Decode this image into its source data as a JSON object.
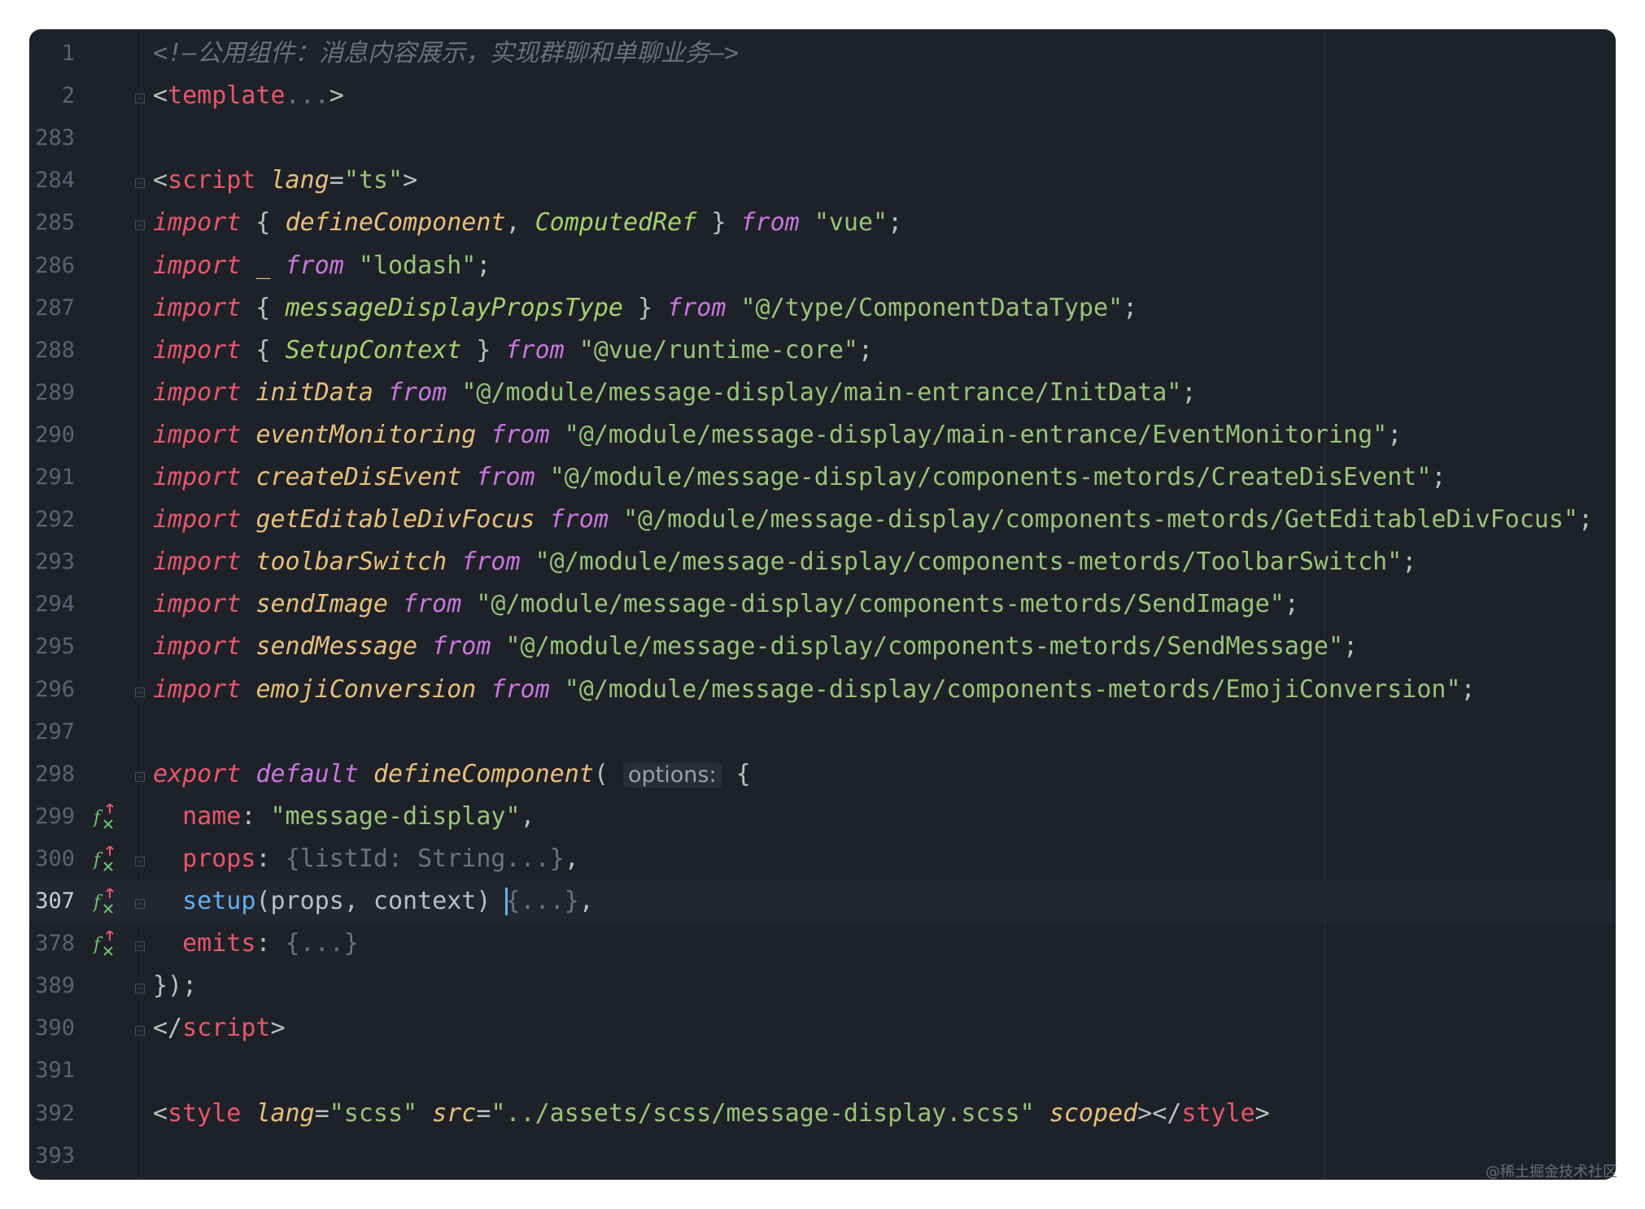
{
  "colors": {
    "background": "#1f2129",
    "keyword": "#e5586b",
    "keyword2": "#c678dd",
    "function": "#e5c07b",
    "string": "#98c379",
    "type": "#a6d06e",
    "comment": "#6b6f7b",
    "setup": "#61afef"
  },
  "editor": {
    "lines": [
      {
        "n": "1",
        "fold": false,
        "icon": null,
        "tokens": [
          {
            "c": "comment",
            "t": "<!—公用组件：消息内容展示，实现群聊和单聊业务—>"
          }
        ]
      },
      {
        "n": "2",
        "fold": true,
        "icon": null,
        "tokens": [
          {
            "c": "plain",
            "t": "<"
          },
          {
            "c": "tag",
            "t": "template"
          },
          {
            "c": "dim",
            "t": "..."
          },
          {
            "c": "plain",
            "t": ">"
          }
        ]
      },
      {
        "n": "283",
        "fold": false,
        "icon": null,
        "tokens": []
      },
      {
        "n": "284",
        "fold": true,
        "icon": null,
        "tokens": [
          {
            "c": "plain",
            "t": "<"
          },
          {
            "c": "tag",
            "t": "script"
          },
          {
            "c": "plain",
            "t": " "
          },
          {
            "c": "attr",
            "t": "lang"
          },
          {
            "c": "plain",
            "t": "="
          },
          {
            "c": "str",
            "t": "\"ts\""
          },
          {
            "c": "plain",
            "t": ">"
          }
        ]
      },
      {
        "n": "285",
        "fold": true,
        "icon": null,
        "tokens": [
          {
            "c": "kw",
            "t": "import"
          },
          {
            "c": "plain",
            "t": " { "
          },
          {
            "c": "fn",
            "t": "defineComponent"
          },
          {
            "c": "plain",
            "t": ", "
          },
          {
            "c": "ty",
            "t": "ComputedRef"
          },
          {
            "c": "plain",
            "t": " } "
          },
          {
            "c": "kw2",
            "t": "from"
          },
          {
            "c": "plain",
            "t": " "
          },
          {
            "c": "str",
            "t": "\"vue\""
          },
          {
            "c": "plain",
            "t": ";"
          }
        ]
      },
      {
        "n": "286",
        "fold": false,
        "icon": null,
        "tokens": [
          {
            "c": "kw",
            "t": "import"
          },
          {
            "c": "plain",
            "t": " "
          },
          {
            "c": "fn",
            "t": "_"
          },
          {
            "c": "plain",
            "t": " "
          },
          {
            "c": "kw2",
            "t": "from"
          },
          {
            "c": "plain",
            "t": " "
          },
          {
            "c": "str",
            "t": "\"lodash\""
          },
          {
            "c": "plain",
            "t": ";"
          }
        ]
      },
      {
        "n": "287",
        "fold": false,
        "icon": null,
        "tokens": [
          {
            "c": "kw",
            "t": "import"
          },
          {
            "c": "plain",
            "t": " { "
          },
          {
            "c": "ty",
            "t": "messageDisplayPropsType"
          },
          {
            "c": "plain",
            "t": " } "
          },
          {
            "c": "kw2",
            "t": "from"
          },
          {
            "c": "plain",
            "t": " "
          },
          {
            "c": "str",
            "t": "\"@/type/ComponentDataType\""
          },
          {
            "c": "plain",
            "t": ";"
          }
        ]
      },
      {
        "n": "288",
        "fold": false,
        "icon": null,
        "tokens": [
          {
            "c": "kw",
            "t": "import"
          },
          {
            "c": "plain",
            "t": " { "
          },
          {
            "c": "ty",
            "t": "SetupContext"
          },
          {
            "c": "plain",
            "t": " } "
          },
          {
            "c": "kw2",
            "t": "from"
          },
          {
            "c": "plain",
            "t": " "
          },
          {
            "c": "str",
            "t": "\"@vue/runtime-core\""
          },
          {
            "c": "plain",
            "t": ";"
          }
        ]
      },
      {
        "n": "289",
        "fold": false,
        "icon": null,
        "tokens": [
          {
            "c": "kw",
            "t": "import"
          },
          {
            "c": "plain",
            "t": " "
          },
          {
            "c": "fn",
            "t": "initData"
          },
          {
            "c": "plain",
            "t": " "
          },
          {
            "c": "kw2",
            "t": "from"
          },
          {
            "c": "plain",
            "t": " "
          },
          {
            "c": "str",
            "t": "\"@/module/message-display/main-entrance/InitData\""
          },
          {
            "c": "plain",
            "t": ";"
          }
        ]
      },
      {
        "n": "290",
        "fold": false,
        "icon": null,
        "tokens": [
          {
            "c": "kw",
            "t": "import"
          },
          {
            "c": "plain",
            "t": " "
          },
          {
            "c": "fn",
            "t": "eventMonitoring"
          },
          {
            "c": "plain",
            "t": " "
          },
          {
            "c": "kw2",
            "t": "from"
          },
          {
            "c": "plain",
            "t": " "
          },
          {
            "c": "str",
            "t": "\"@/module/message-display/main-entrance/EventMonitoring\""
          },
          {
            "c": "plain",
            "t": ";"
          }
        ]
      },
      {
        "n": "291",
        "fold": false,
        "icon": null,
        "tokens": [
          {
            "c": "kw",
            "t": "import"
          },
          {
            "c": "plain",
            "t": " "
          },
          {
            "c": "fn",
            "t": "createDisEvent"
          },
          {
            "c": "plain",
            "t": " "
          },
          {
            "c": "kw2",
            "t": "from"
          },
          {
            "c": "plain",
            "t": " "
          },
          {
            "c": "str",
            "t": "\"@/module/message-display/components-metords/CreateDisEvent\""
          },
          {
            "c": "plain",
            "t": ";"
          }
        ]
      },
      {
        "n": "292",
        "fold": false,
        "icon": null,
        "tokens": [
          {
            "c": "kw",
            "t": "import"
          },
          {
            "c": "plain",
            "t": " "
          },
          {
            "c": "fn",
            "t": "getEditableDivFocus"
          },
          {
            "c": "plain",
            "t": " "
          },
          {
            "c": "kw2",
            "t": "from"
          },
          {
            "c": "plain",
            "t": " "
          },
          {
            "c": "str",
            "t": "\"@/module/message-display/components-metords/GetEditableDivFocus\""
          },
          {
            "c": "plain",
            "t": ";"
          }
        ]
      },
      {
        "n": "293",
        "fold": false,
        "icon": null,
        "tokens": [
          {
            "c": "kw",
            "t": "import"
          },
          {
            "c": "plain",
            "t": " "
          },
          {
            "c": "fn",
            "t": "toolbarSwitch"
          },
          {
            "c": "plain",
            "t": " "
          },
          {
            "c": "kw2",
            "t": "from"
          },
          {
            "c": "plain",
            "t": " "
          },
          {
            "c": "str",
            "t": "\"@/module/message-display/components-metords/ToolbarSwitch\""
          },
          {
            "c": "plain",
            "t": ";"
          }
        ]
      },
      {
        "n": "294",
        "fold": false,
        "icon": null,
        "tokens": [
          {
            "c": "kw",
            "t": "import"
          },
          {
            "c": "plain",
            "t": " "
          },
          {
            "c": "fn",
            "t": "sendImage"
          },
          {
            "c": "plain",
            "t": " "
          },
          {
            "c": "kw2",
            "t": "from"
          },
          {
            "c": "plain",
            "t": " "
          },
          {
            "c": "str",
            "t": "\"@/module/message-display/components-metords/SendImage\""
          },
          {
            "c": "plain",
            "t": ";"
          }
        ]
      },
      {
        "n": "295",
        "fold": false,
        "icon": null,
        "tokens": [
          {
            "c": "kw",
            "t": "import"
          },
          {
            "c": "plain",
            "t": " "
          },
          {
            "c": "fn",
            "t": "sendMessage"
          },
          {
            "c": "plain",
            "t": " "
          },
          {
            "c": "kw2",
            "t": "from"
          },
          {
            "c": "plain",
            "t": " "
          },
          {
            "c": "str",
            "t": "\"@/module/message-display/components-metords/SendMessage\""
          },
          {
            "c": "plain",
            "t": ";"
          }
        ]
      },
      {
        "n": "296",
        "fold": true,
        "icon": null,
        "tokens": [
          {
            "c": "kw",
            "t": "import"
          },
          {
            "c": "plain",
            "t": " "
          },
          {
            "c": "fn",
            "t": "emojiConversion"
          },
          {
            "c": "plain",
            "t": " "
          },
          {
            "c": "kw2",
            "t": "from"
          },
          {
            "c": "plain",
            "t": " "
          },
          {
            "c": "str",
            "t": "\"@/module/message-display/components-metords/EmojiConversion\""
          },
          {
            "c": "plain",
            "t": ";"
          }
        ]
      },
      {
        "n": "297",
        "fold": false,
        "icon": null,
        "tokens": []
      },
      {
        "n": "298",
        "fold": true,
        "icon": null,
        "tokens": [
          {
            "c": "kw",
            "t": "export"
          },
          {
            "c": "plain",
            "t": " "
          },
          {
            "c": "kw2",
            "t": "default"
          },
          {
            "c": "plain",
            "t": " "
          },
          {
            "c": "fn",
            "t": "defineComponent"
          },
          {
            "c": "plain",
            "t": "( "
          },
          {
            "c": "hint",
            "t": "options:"
          },
          {
            "c": "plain",
            "t": " {"
          }
        ]
      },
      {
        "n": "299",
        "fold": false,
        "icon": "vue-property-icon",
        "tokens": [
          {
            "c": "plain",
            "t": "  "
          },
          {
            "c": "prop",
            "t": "name"
          },
          {
            "c": "plain",
            "t": ": "
          },
          {
            "c": "str",
            "t": "\"message-display\""
          },
          {
            "c": "plain",
            "t": ","
          }
        ]
      },
      {
        "n": "300",
        "fold": true,
        "icon": "vue-property-icon",
        "tokens": [
          {
            "c": "plain",
            "t": "  "
          },
          {
            "c": "prop",
            "t": "props"
          },
          {
            "c": "plain",
            "t": ": "
          },
          {
            "c": "dim",
            "t": "{listId: String...}"
          },
          {
            "c": "plain",
            "t": ","
          }
        ]
      },
      {
        "n": "307",
        "fold": true,
        "icon": "vue-property-icon",
        "current": true,
        "tokens": [
          {
            "c": "plain",
            "t": "  "
          },
          {
            "c": "setup",
            "t": "setup"
          },
          {
            "c": "plain",
            "t": "(props, context) "
          },
          {
            "c": "caret",
            "t": ""
          },
          {
            "c": "dim",
            "t": "{...}"
          },
          {
            "c": "plain",
            "t": ","
          }
        ]
      },
      {
        "n": "378",
        "fold": true,
        "icon": "vue-property-icon",
        "tokens": [
          {
            "c": "plain",
            "t": "  "
          },
          {
            "c": "prop",
            "t": "emits"
          },
          {
            "c": "plain",
            "t": ": "
          },
          {
            "c": "dim",
            "t": "{...}"
          }
        ]
      },
      {
        "n": "389",
        "fold": true,
        "icon": null,
        "tokens": [
          {
            "c": "plain",
            "t": "});"
          }
        ]
      },
      {
        "n": "390",
        "fold": true,
        "icon": null,
        "tokens": [
          {
            "c": "plain",
            "t": "</"
          },
          {
            "c": "tag",
            "t": "script"
          },
          {
            "c": "plain",
            "t": ">"
          }
        ]
      },
      {
        "n": "391",
        "fold": false,
        "icon": null,
        "tokens": []
      },
      {
        "n": "392",
        "fold": false,
        "icon": null,
        "tokens": [
          {
            "c": "plain",
            "t": "<"
          },
          {
            "c": "tag",
            "t": "style"
          },
          {
            "c": "plain",
            "t": " "
          },
          {
            "c": "attr",
            "t": "lang"
          },
          {
            "c": "plain",
            "t": "="
          },
          {
            "c": "str",
            "t": "\"scss\""
          },
          {
            "c": "plain",
            "t": " "
          },
          {
            "c": "attr",
            "t": "src"
          },
          {
            "c": "plain",
            "t": "="
          },
          {
            "c": "str",
            "t": "\"../assets/scss/message-display.scss\""
          },
          {
            "c": "plain",
            "t": " "
          },
          {
            "c": "attr",
            "t": "scoped"
          },
          {
            "c": "plain",
            "t": "></"
          },
          {
            "c": "tag",
            "t": "style"
          },
          {
            "c": "plain",
            "t": ">"
          }
        ]
      },
      {
        "n": "393",
        "fold": false,
        "icon": null,
        "tokens": []
      }
    ]
  },
  "watermark": "@稀土掘金技术社区"
}
